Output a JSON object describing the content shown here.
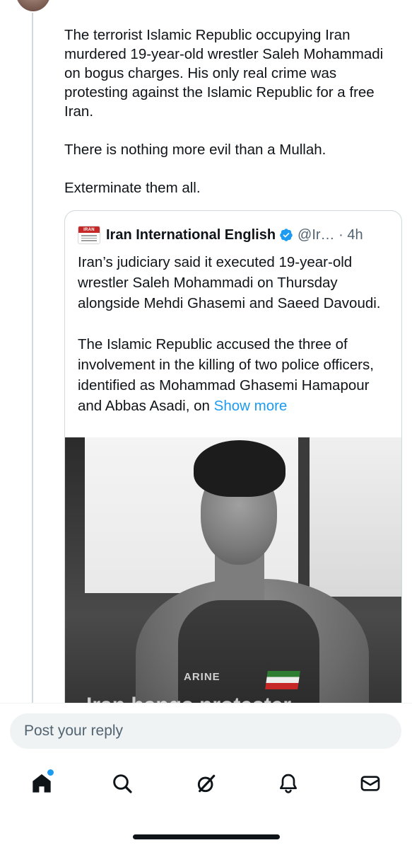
{
  "tweet": {
    "paragraphs": [
      "The terrorist Islamic Republic occupying Iran murdered 19-year-old wrestler Saleh Mohammadi on bogus charges. His only real crime was protesting against the Islamic Republic for a free Iran.",
      "There is nothing more evil than a Mullah.",
      "Exterminate them all."
    ]
  },
  "quote": {
    "logo_text": "IRAN",
    "display_name": "Iran International English",
    "handle_meta": "@Ir… · 4h",
    "paragraph_1": "Iran’s judiciary said it executed 19-year-old wrestler Saleh Mohammadi on Thursday alongside Mehdi Ghasemi and Saeed Davoudi.",
    "paragraph_2": "The Islamic Republic accused the three of involvement in the killing of two police officers, identified as Mohammad Ghasemi Hamapour and Abbas Asadi, on",
    "show_more": "Show more",
    "image_jersey_text": "ARINE",
    "image_overlay_text": "Iran hangs protester"
  },
  "reply": {
    "placeholder": "Post your reply"
  },
  "nav": {
    "items": [
      "home-icon",
      "search-icon",
      "grok-icon",
      "notifications-icon",
      "messages-icon"
    ],
    "accent_color": "#1d9bf0"
  }
}
